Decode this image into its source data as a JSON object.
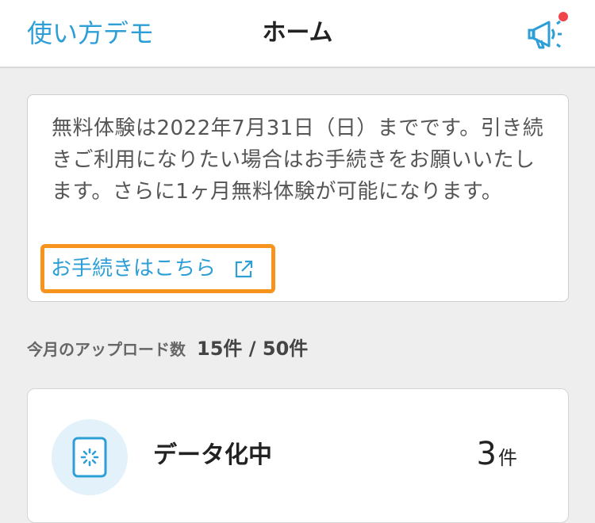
{
  "header": {
    "left_label": "使い方デモ",
    "title": "ホーム",
    "notification_icon": "megaphone-icon",
    "notification_dot_color": "#f0444a"
  },
  "notice": {
    "message": "無料体験は2022年7月31日（日）までです。引き続きご利用になりたい場合はお手続きをお願いいたします。さらに1ヶ月無料体験が可能になります。",
    "link_label": "お手続きはこちら",
    "link_icon": "external-link-icon",
    "highlight_color": "#f7941d"
  },
  "uploads": {
    "label": "今月のアップロード数",
    "count": "15件 / 50件"
  },
  "status": {
    "label": "データ化中",
    "count": "3",
    "unit": "件",
    "icon": "loading-document-icon"
  },
  "colors": {
    "accent": "#2d9fd6",
    "background": "#eeeeee"
  }
}
